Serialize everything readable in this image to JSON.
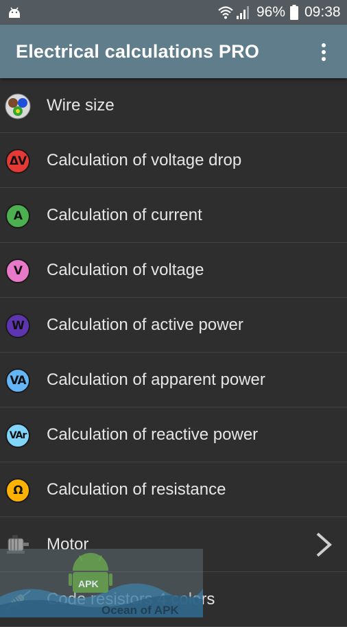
{
  "status_bar": {
    "battery_percent": "96%",
    "time": "09:38"
  },
  "app_bar": {
    "title": "Electrical calculations PRO",
    "menu_icon": "overflow-menu-icon"
  },
  "menu": {
    "items": [
      {
        "label": "Wire size",
        "icon": "wire-size-icon"
      },
      {
        "label": "Calculation of voltage drop",
        "icon": "voltage-drop-icon",
        "icon_text": "ΔV",
        "icon_color": "#e53935"
      },
      {
        "label": "Calculation of current",
        "icon": "current-icon",
        "icon_text": "A",
        "icon_color": "#4caf50"
      },
      {
        "label": "Calculation of voltage",
        "icon": "voltage-icon",
        "icon_text": "V",
        "icon_color": "#e879c8"
      },
      {
        "label": "Calculation of active power",
        "icon": "active-power-icon",
        "icon_text": "W",
        "icon_color": "#5e35b1"
      },
      {
        "label": "Calculation of apparent power",
        "icon": "apparent-power-icon",
        "icon_text": "VA",
        "icon_color": "#64b5f6"
      },
      {
        "label": "Calculation of reactive power",
        "icon": "reactive-power-icon",
        "icon_text": "VAr",
        "icon_color": "#81d4fa"
      },
      {
        "label": "Calculation of resistance",
        "icon": "resistance-icon",
        "icon_text": "Ω",
        "icon_color": "#ffb300"
      },
      {
        "label": "Motor",
        "icon": "motor-icon",
        "has_submenu": true
      },
      {
        "label": "Code resistors 4 colors",
        "icon": "resistor-icon"
      }
    ]
  },
  "watermark": {
    "badge": "APK",
    "text": "Ocean of APK"
  }
}
